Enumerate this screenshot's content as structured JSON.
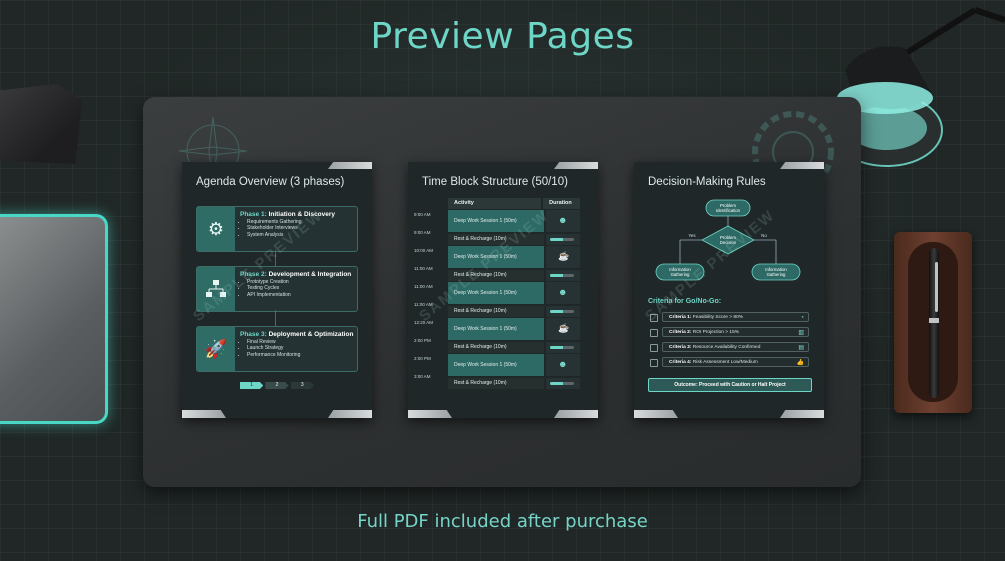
{
  "header": {
    "title": "Preview Pages"
  },
  "footer": {
    "text": "Full PDF included after purchase"
  },
  "watermark": "SAMPLE PREVIEW",
  "page1": {
    "title": "Agenda Overview (3 phases)",
    "phases": [
      {
        "num": "Phase 1:",
        "name": "Initiation & Discovery",
        "icon": "gear-icon",
        "items": [
          "Requirements Gathering",
          "Stakeholder Interviews",
          "System Analysis"
        ]
      },
      {
        "num": "Phase 2:",
        "name": "Development & Integration",
        "icon": "flowchart-icon",
        "items": [
          "Prototype Creation",
          "Testing Cycles",
          "API Implementation"
        ]
      },
      {
        "num": "Phase 3:",
        "name": "Deployment & Optimization",
        "icon": "rocket-icon",
        "items": [
          "Final Review",
          "Launch Strategy",
          "Performance Monitoring"
        ]
      }
    ],
    "stepper": [
      "1",
      "2",
      "3"
    ]
  },
  "page2": {
    "title": "Time Block Structure (50/10)",
    "col_activity": "Activity",
    "col_duration": "Duration",
    "times": [
      "9:00 AM",
      "9:00 AM",
      "10:00 AM",
      "11:00 AM",
      "11:00 AM",
      "11:00 AM",
      "12:20 AM",
      "2:00 PM",
      "2:00 PM",
      "3:00 AM"
    ],
    "rows": [
      {
        "type": "deep",
        "label": "Deep Work Session 1 (50m)",
        "icon": "brain-icon"
      },
      {
        "type": "rest",
        "label": "Rest & Recharge (10m)",
        "progress": 0.55
      },
      {
        "type": "deep",
        "label": "Deep Work Session 1 (50m)",
        "icon": "coffee-icon"
      },
      {
        "type": "rest",
        "label": "Rest & Recharge (10m)",
        "progress": 0.55
      },
      {
        "type": "deep",
        "label": "Deep Work Session 1 (50m)",
        "icon": "brain-icon"
      },
      {
        "type": "rest",
        "label": "Rest & Recharge (10m)",
        "progress": 0.55
      },
      {
        "type": "deep",
        "label": "Deep Work Session 1 (50m)",
        "icon": "coffee-icon"
      },
      {
        "type": "rest",
        "label": "Rest & Recharge (10m)",
        "progress": 0.55
      },
      {
        "type": "deep",
        "label": "Deep Work Session 1 (50m)",
        "icon": "brain-icon"
      },
      {
        "type": "rest",
        "label": "Rest & Recharge (10m)",
        "progress": 0.55
      }
    ]
  },
  "page3": {
    "title": "Decision-Making Rules",
    "flow": {
      "start": "Problem Identification",
      "decision": "Problem Decision",
      "yes": "Yes",
      "no": "No",
      "left": "Information Gathering",
      "right": "Information Gathering"
    },
    "criteria_title": "Criteria for Go/No-Go:",
    "criteria": [
      {
        "label": "Criteria 1:",
        "text": "Feasibility Score > 80%",
        "icon": "gauge-icon"
      },
      {
        "label": "Criteria 2:",
        "text": "ROI Projection > 15%",
        "icon": "chart-icon"
      },
      {
        "label": "Criteria 3:",
        "text": "Resource Availability Confirmed",
        "icon": "clipboard-icon"
      },
      {
        "label": "Criteria 4:",
        "text": "Risk Assessment Low/Medium",
        "icon": "thumbs-up-icon"
      }
    ],
    "outcome": "Outcome: Proceed with Caution or Halt Project"
  },
  "colors": {
    "accent": "#6ed6c7",
    "bg": "#202726",
    "card": "#1f2728",
    "teal_dark": "#2e6a65"
  }
}
